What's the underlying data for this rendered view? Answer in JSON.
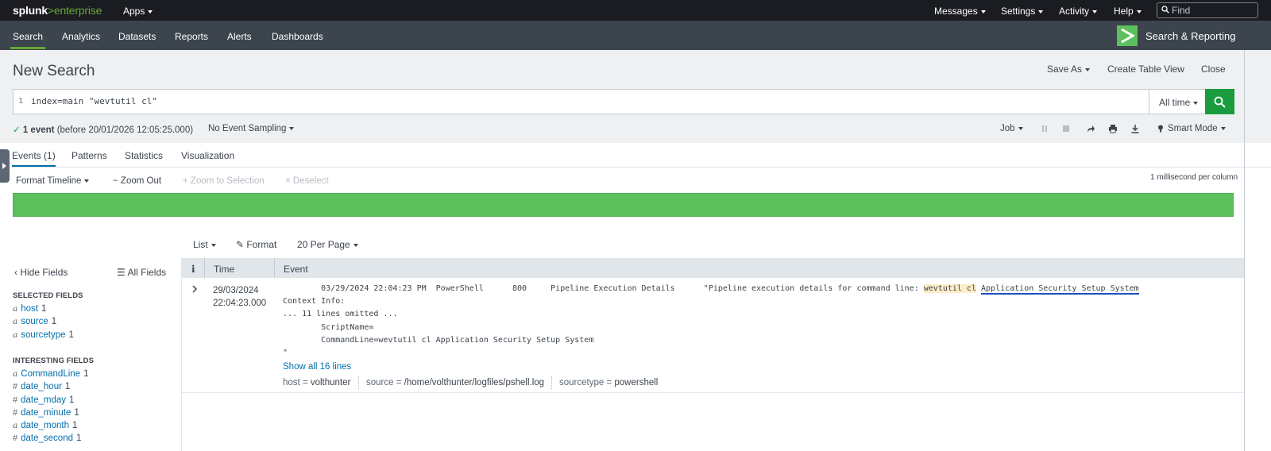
{
  "topbar": {
    "logo_brand": "splunk",
    "logo_sep": ">",
    "logo_product": "enterprise",
    "apps": "Apps",
    "messages": "Messages",
    "settings": "Settings",
    "activity": "Activity",
    "help": "Help",
    "find_placeholder": "Find"
  },
  "appbar": {
    "nav": [
      "Search",
      "Analytics",
      "Datasets",
      "Reports",
      "Alerts",
      "Dashboards"
    ],
    "app_title": "Search & Reporting"
  },
  "header": {
    "title": "New Search",
    "save_as": "Save As",
    "create_table_view": "Create Table View",
    "close": "Close"
  },
  "search": {
    "line_number": "1",
    "query": "index=main \"wevtutil cl\"",
    "time_range": "All time"
  },
  "status": {
    "check": "✓",
    "count": "1 event",
    "detail": "(before 20/01/2026 12:05:25.000)",
    "sampling": "No Event Sampling",
    "job": "Job",
    "mode": "Smart Mode"
  },
  "tabs": [
    "Events (1)",
    "Patterns",
    "Statistics",
    "Visualization"
  ],
  "timeline": {
    "format": "Format Timeline",
    "zoom_out": "Zoom Out",
    "zoom_selection": "Zoom to Selection",
    "deselect": "Deselect",
    "scale": "1 millisecond per column"
  },
  "results_toolbar": {
    "list": "List",
    "format": "Format",
    "per_page": "20 Per Page"
  },
  "sidebar": {
    "hide_fields": "Hide Fields",
    "all_fields": "All Fields",
    "selected_heading": "SELECTED FIELDS",
    "selected": [
      {
        "type": "a",
        "name": "host",
        "count": "1"
      },
      {
        "type": "a",
        "name": "source",
        "count": "1"
      },
      {
        "type": "a",
        "name": "sourcetype",
        "count": "1"
      }
    ],
    "interesting_heading": "INTERESTING FIELDS",
    "interesting": [
      {
        "type": "a",
        "name": "CommandLine",
        "count": "1"
      },
      {
        "type": "#",
        "name": "date_hour",
        "count": "1"
      },
      {
        "type": "#",
        "name": "date_mday",
        "count": "1"
      },
      {
        "type": "#",
        "name": "date_minute",
        "count": "1"
      },
      {
        "type": "a",
        "name": "date_month",
        "count": "1"
      },
      {
        "type": "#",
        "name": "date_second",
        "count": "1"
      }
    ]
  },
  "table": {
    "col_info": "i",
    "col_time": "Time",
    "col_event": "Event",
    "event": {
      "date": "29/03/2024",
      "time": "22:04:23.000",
      "line1_prefix": "        03/29/2024 22:04:23 PM  PowerShell      800     Pipeline Execution Details      \"Pipeline execution details for command line: ",
      "line1_hl": "wevtutil cl",
      "line1_suffix": "Application Security Setup System",
      "line2": "Context Info:",
      "line3": "... 11 lines omitted ...",
      "line4": "        ScriptName=",
      "line5": "        CommandLine=wevtutil cl Application Security Setup System",
      "line6": "\"",
      "show_all": "Show all 16 lines",
      "fields": [
        {
          "key": "host",
          "value": "volthunter"
        },
        {
          "key": "source",
          "value": "/home/volthunter/logfiles/pshell.log"
        },
        {
          "key": "sourcetype",
          "value": "powershell"
        }
      ]
    }
  }
}
